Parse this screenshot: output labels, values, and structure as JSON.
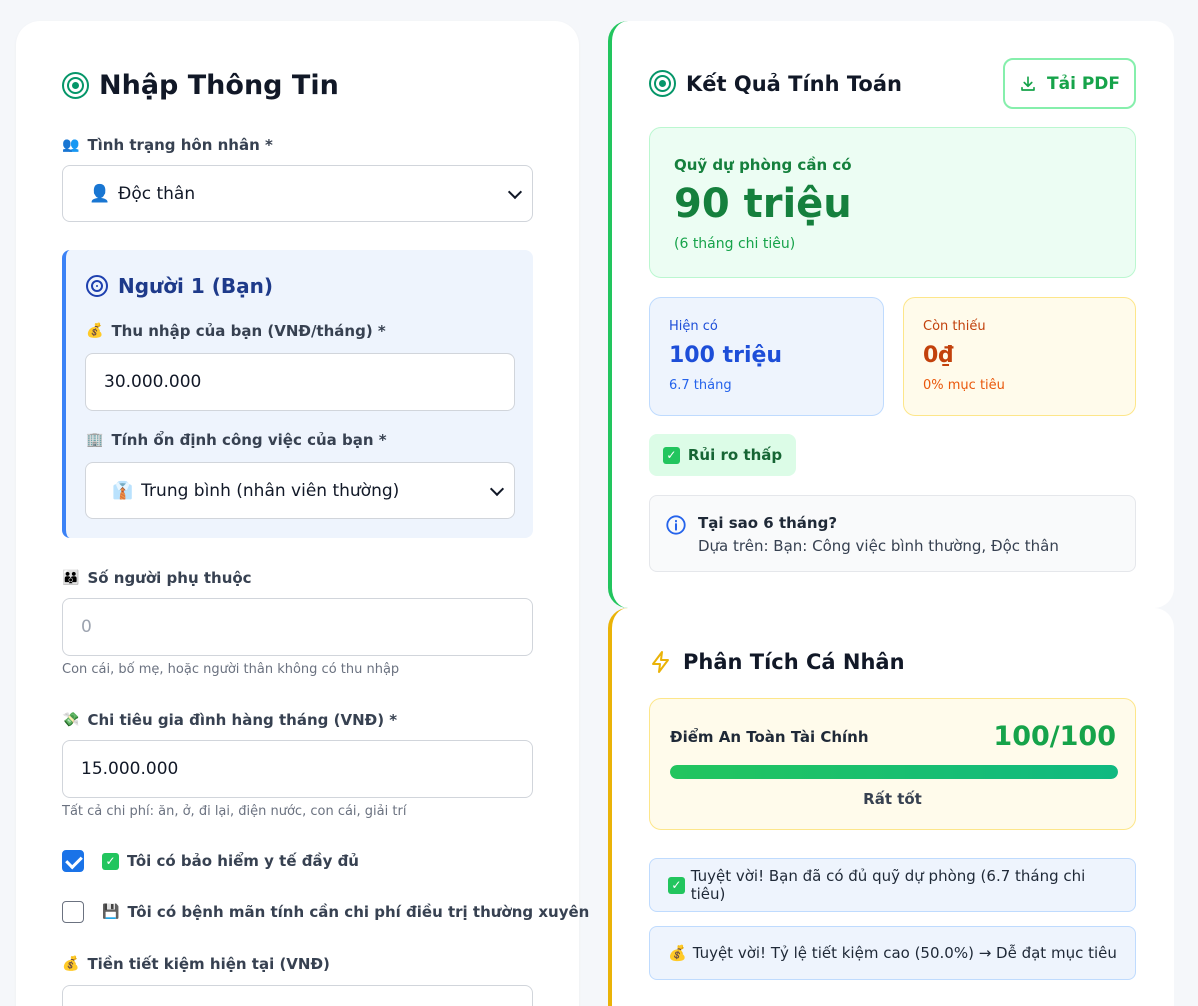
{
  "left": {
    "title": "Nhập Thông Tin",
    "marital": {
      "label": "Tình trạng hôn nhân *",
      "emoji": "👥",
      "value": "Độc thân",
      "value_emoji": "👤"
    },
    "person": {
      "title": "Người 1 (Bạn)",
      "income": {
        "label": "Thu nhập của bạn (VNĐ/tháng) *",
        "emoji": "💰",
        "value": "30.000.000"
      },
      "stability": {
        "label": "Tính ổn định công việc của bạn *",
        "emoji": "🏢",
        "value": "Trung bình (nhân viên thường)",
        "value_emoji": "👔"
      }
    },
    "dependents": {
      "label": "Số người phụ thuộc",
      "emoji": "👪",
      "placeholder": "0",
      "hint": "Con cái, bố mẹ, hoặc người thân không có thu nhập"
    },
    "expenses": {
      "label": "Chi tiêu gia đình hàng tháng (VNĐ) *",
      "emoji": "💸",
      "value": "15.000.000",
      "hint": "Tất cả chi phí: ăn, ở, đi lại, điện nước, con cái, giải trí"
    },
    "insurance": {
      "label": "Tôi có bảo hiểm y tế đầy đủ",
      "checked": true
    },
    "chronic": {
      "label": "Tôi có bệnh mãn tính cần chi phí điều trị thường xuyên",
      "emoji": "💾",
      "checked": false
    },
    "savings": {
      "label": "Tiền tiết kiệm hiện tại (VNĐ)",
      "emoji": "💰"
    }
  },
  "result": {
    "title": "Kết Quả Tính Toán",
    "pdf_label": "Tải PDF",
    "fund_label": "Quỹ dự phòng cần có",
    "fund_value": "90 triệu",
    "fund_sub": "(6 tháng chi tiêu)",
    "have_label": "Hiện có",
    "have_value": "100 triệu",
    "have_sub": "6.7 tháng",
    "miss_label": "Còn thiếu",
    "miss_value": "0₫",
    "miss_sub": "0% mục tiêu",
    "risk_label": "Rủi ro thấp",
    "why_title": "Tại sao 6 tháng?",
    "why_text": "Dựa trên: Bạn: Công việc bình thường, Độc thân"
  },
  "analysis": {
    "title": "Phân Tích Cá Nhân",
    "score_label": "Điểm An Toàn Tài Chính",
    "score_value": "100/100",
    "score_percent": 100,
    "score_rating": "Rất tốt",
    "note1": "Tuyệt vời! Bạn đã có đủ quỹ dự phòng (6.7 tháng chi tiêu)",
    "note2": "Tuyệt vời! Tỷ lệ tiết kiệm cao (50.0%) → Dễ đạt mục tiêu",
    "note2_emoji": "💰"
  },
  "colors": {
    "accent_green": "#16a34a",
    "accent_blue": "#1e40af",
    "accent_amber": "#eab308",
    "warn_red": "#c2410c"
  }
}
